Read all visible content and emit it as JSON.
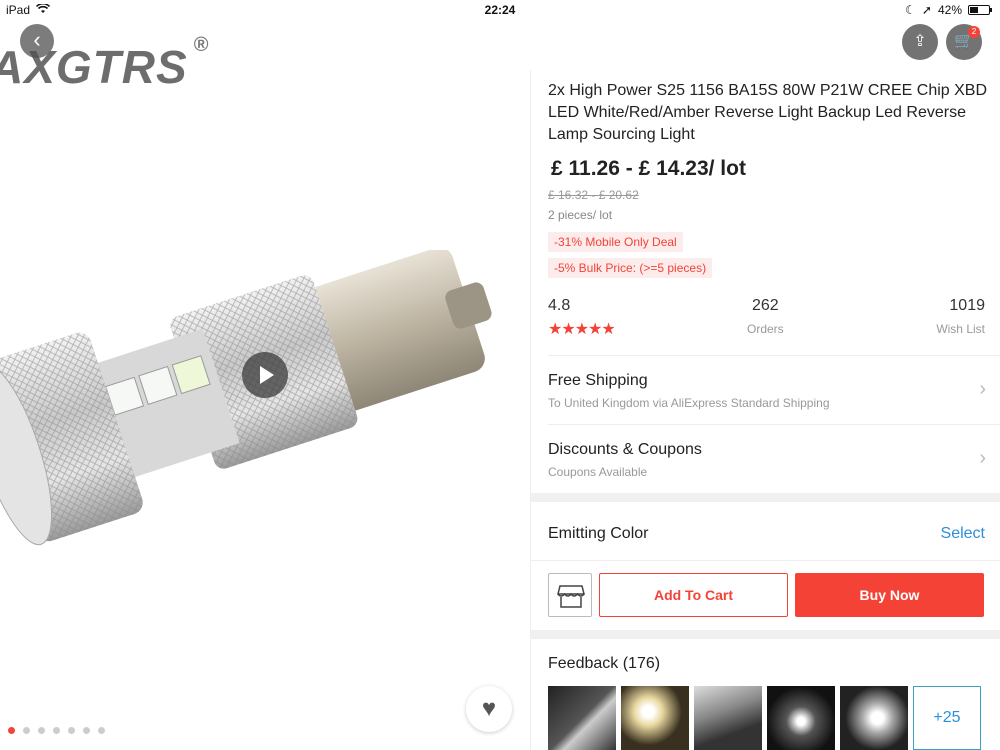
{
  "status_bar": {
    "device": "iPad",
    "time": "22:24",
    "battery": "42%",
    "battery_level": 0.42
  },
  "gallery": {
    "brand": "AXGTRS",
    "brand_mark": "®",
    "dot_count": 7,
    "active_dot": 0
  },
  "icons": {
    "back": "back-icon",
    "share": "share-icon",
    "cart": "cart-icon",
    "favorite": "heart-icon",
    "play": "play-icon"
  },
  "cart_count": "2",
  "product": {
    "title": "2x High Power S25 1156 BA15S 80W P21W CREE Chip XBD LED White/Red/Amber Reverse Light Backup Led Reverse Lamp Sourcing Light",
    "price": "£ 11.26 - £ 14.23/ lot",
    "old_price": "£ 16.32 - £ 20.62",
    "per_lot": "2 pieces/ lot",
    "tag_mobile": "-31% Mobile Only Deal",
    "tag_bulk": "-5% Bulk Price: (>=5 pieces)"
  },
  "stats": {
    "rating": "4.8",
    "rating_stars": 4.8,
    "stars_glyphs": "★★★★★",
    "orders_value": "262",
    "orders_label": "Orders",
    "wishlist_value": "1019",
    "wishlist_label": "Wish List"
  },
  "shipping": {
    "title": "Free Shipping",
    "subtitle": "To United Kingdom via AliExpress Standard Shipping"
  },
  "coupons": {
    "title": "Discounts & Coupons",
    "subtitle": "Coupons Available"
  },
  "color": {
    "label": "Emitting Color",
    "action": "Select"
  },
  "actions": {
    "add_to_cart": "Add To Cart",
    "buy_now": "Buy Now"
  },
  "feedback": {
    "title": "Feedback (176)",
    "more": "+25"
  },
  "colors": {
    "accent": "#f44336",
    "link": "#2a90d9"
  }
}
